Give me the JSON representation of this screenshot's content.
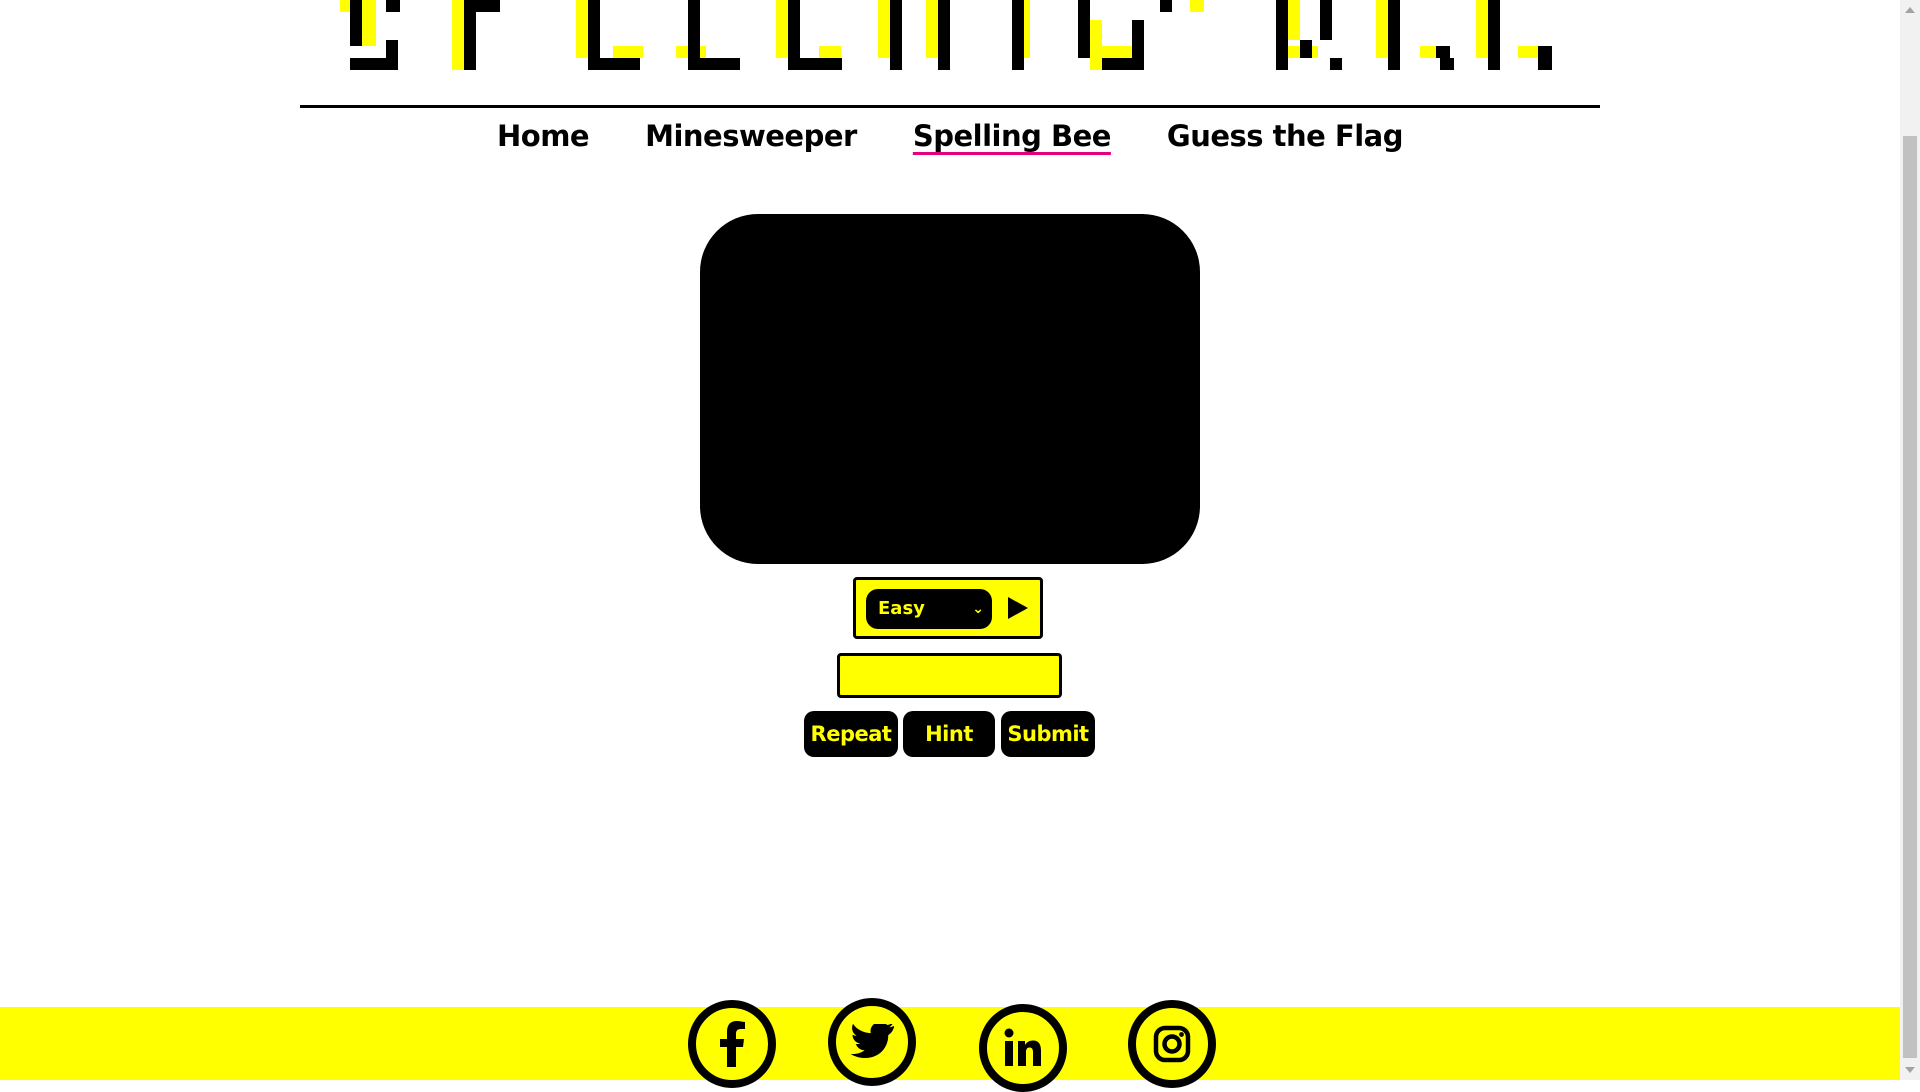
{
  "banner": {
    "title": "SPELLING BEE"
  },
  "nav": {
    "items": [
      {
        "label": "Home",
        "active": false
      },
      {
        "label": "Minesweeper",
        "active": false
      },
      {
        "label": "Spelling Bee",
        "active": true
      },
      {
        "label": "Guess the Flag",
        "active": false
      }
    ]
  },
  "controls": {
    "difficulty_selected": "Easy",
    "answer_value": "",
    "repeat_label": "Repeat",
    "hint_label": "Hint",
    "submit_label": "Submit"
  },
  "footer": {
    "social_icons": [
      "facebook-icon",
      "twitter-icon",
      "linkedin-icon",
      "instagram-icon"
    ]
  },
  "colors": {
    "accent": "#ffff00",
    "primary": "#000000",
    "active_underline": "#e6007e",
    "background": "#ffffff"
  }
}
